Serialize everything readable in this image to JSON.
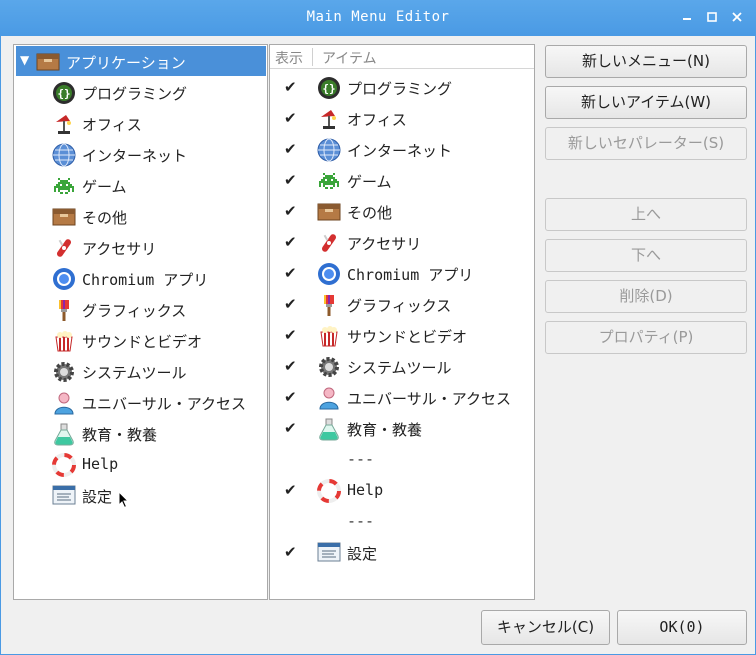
{
  "window": {
    "title": "Main Menu Editor",
    "controls": {
      "minimize": "–",
      "maximize": "□",
      "close": "×"
    }
  },
  "tree": {
    "root": {
      "label": "アプリケーション",
      "icon": "folder-icon",
      "expanded": true,
      "selected": true
    },
    "items": [
      {
        "label": "プログラミング",
        "icon": "programming-icon"
      },
      {
        "label": "オフィス",
        "icon": "office-icon"
      },
      {
        "label": "インターネット",
        "icon": "internet-icon"
      },
      {
        "label": "ゲーム",
        "icon": "game-icon"
      },
      {
        "label": "その他",
        "icon": "other-icon"
      },
      {
        "label": "アクセサリ",
        "icon": "accessories-icon"
      },
      {
        "label": "Chromium アプリ",
        "icon": "chromium-icon"
      },
      {
        "label": "グラフィックス",
        "icon": "graphics-icon"
      },
      {
        "label": "サウンドとビデオ",
        "icon": "multimedia-icon"
      },
      {
        "label": "システムツール",
        "icon": "system-tools-icon"
      },
      {
        "label": "ユニバーサル・アクセス",
        "icon": "universal-access-icon"
      },
      {
        "label": "教育・教養",
        "icon": "education-icon"
      },
      {
        "label": "Help",
        "icon": "help-icon"
      },
      {
        "label": "設定",
        "icon": "settings-icon"
      }
    ]
  },
  "items_list": {
    "columns": {
      "show": "表示",
      "item": "アイテム"
    },
    "rows": [
      {
        "type": "item",
        "checked": true,
        "label": "プログラミング",
        "icon": "programming-icon"
      },
      {
        "type": "item",
        "checked": true,
        "label": "オフィス",
        "icon": "office-icon"
      },
      {
        "type": "item",
        "checked": true,
        "label": "インターネット",
        "icon": "internet-icon"
      },
      {
        "type": "item",
        "checked": true,
        "label": "ゲーム",
        "icon": "game-icon"
      },
      {
        "type": "item",
        "checked": true,
        "label": "その他",
        "icon": "other-icon"
      },
      {
        "type": "item",
        "checked": true,
        "label": "アクセサリ",
        "icon": "accessories-icon"
      },
      {
        "type": "item",
        "checked": true,
        "label": "Chromium アプリ",
        "icon": "chromium-icon"
      },
      {
        "type": "item",
        "checked": true,
        "label": "グラフィックス",
        "icon": "graphics-icon"
      },
      {
        "type": "item",
        "checked": true,
        "label": "サウンドとビデオ",
        "icon": "multimedia-icon"
      },
      {
        "type": "item",
        "checked": true,
        "label": "システムツール",
        "icon": "system-tools-icon"
      },
      {
        "type": "item",
        "checked": true,
        "label": "ユニバーサル・アクセス",
        "icon": "universal-access-icon"
      },
      {
        "type": "item",
        "checked": true,
        "label": "教育・教養",
        "icon": "education-icon"
      },
      {
        "type": "separator",
        "label": "---"
      },
      {
        "type": "item",
        "checked": true,
        "label": "Help",
        "icon": "help-icon"
      },
      {
        "type": "separator",
        "label": "---"
      },
      {
        "type": "item",
        "checked": true,
        "label": "設定",
        "icon": "settings-icon"
      }
    ],
    "check_glyph": "✔"
  },
  "buttons": {
    "new_menu": {
      "label": "新しいメニュー(N)",
      "enabled": true
    },
    "new_item": {
      "label": "新しいアイテム(W)",
      "enabled": true
    },
    "new_separator": {
      "label": "新しいセパレーター(S)",
      "enabled": false
    },
    "move_up": {
      "label": "上へ",
      "enabled": false
    },
    "move_down": {
      "label": "下へ",
      "enabled": false
    },
    "delete": {
      "label": "削除(D)",
      "enabled": false
    },
    "properties": {
      "label": "プロパティ(P)",
      "enabled": false
    }
  },
  "footer": {
    "cancel": "キャンセル(C)",
    "ok": "OK(0)"
  },
  "colors": {
    "titlebar": "#4a9ae4",
    "selection": "#4a90d9",
    "window_bg": "#f0f0f0",
    "disabled_text": "#9a9a9a"
  }
}
